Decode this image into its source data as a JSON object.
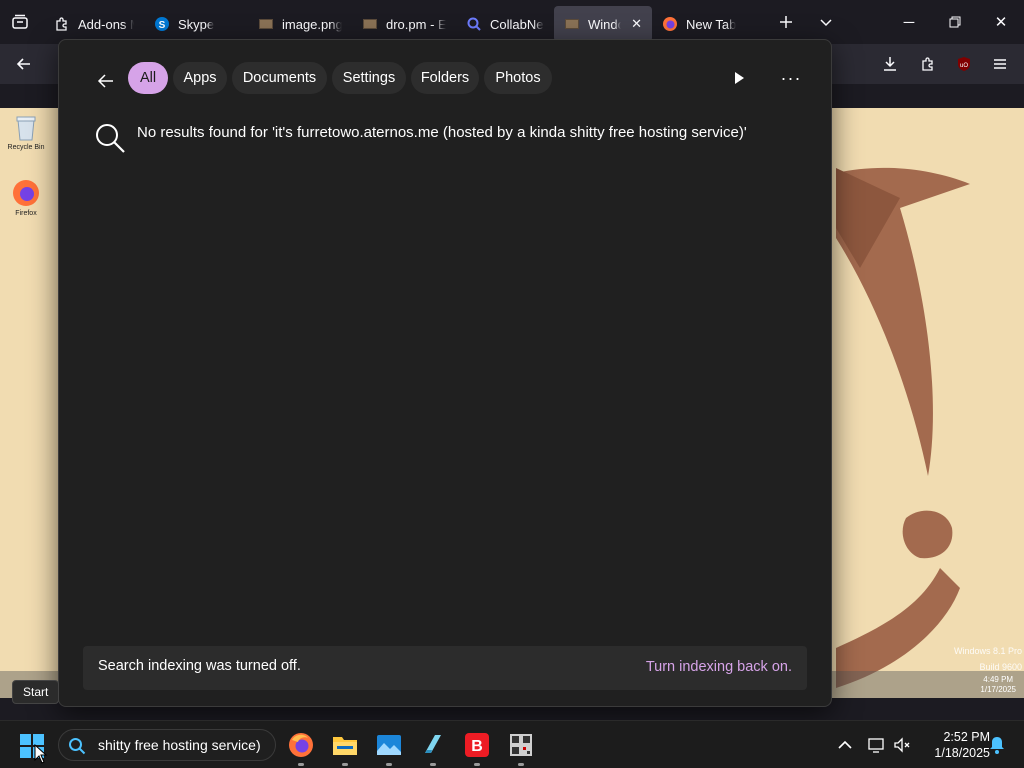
{
  "browser": {
    "tabs": [
      {
        "label": "Add-ons M",
        "icon": "puzzle-icon"
      },
      {
        "label": "Skype",
        "icon": "skype-icon"
      },
      {
        "label": "image.png",
        "icon": "image-icon"
      },
      {
        "label": "dro.pm - E",
        "icon": "image-icon"
      },
      {
        "label": "CollabNet S",
        "icon": "search-icon"
      },
      {
        "label": "Window",
        "icon": "image-icon",
        "active": true
      },
      {
        "label": "New Tab",
        "icon": "firefox-icon"
      }
    ],
    "window_controls": [
      "minimize-icon",
      "restore-icon",
      "close-icon"
    ]
  },
  "desktop": {
    "icons": [
      {
        "label": "Recycle Bin"
      },
      {
        "label": "Firefox"
      }
    ],
    "watermark": [
      "Windows 8.1 Pro",
      "Build 9600"
    ],
    "mini_clock": [
      "4:49 PM",
      "1/17/2025"
    ]
  },
  "search_flyout": {
    "filters": [
      "All",
      "Apps",
      "Documents",
      "Settings",
      "Folders",
      "Photos"
    ],
    "active_filter": "All",
    "no_results_text": "No results found for 'it's furretowo.aternos.me (hosted by a kinda shitty free hosting service)'",
    "indexing_message": "Search indexing was turned off.",
    "indexing_link": "Turn indexing back on."
  },
  "tooltip": {
    "text": "Start"
  },
  "taskbar": {
    "search_value": "shitty free hosting service)",
    "apps": [
      "firefox-icon",
      "file-explorer-icon",
      "photos-icon",
      "notepad-icon",
      "bitdefender-icon",
      "qr-app-icon"
    ],
    "clock": {
      "time": "2:52 PM",
      "date": "1/18/2025"
    }
  },
  "colors": {
    "accent": "#d6a3e8",
    "flyout_bg": "#202020",
    "wallpaper": "#f1dcb1",
    "furret": "#a36a4e"
  }
}
